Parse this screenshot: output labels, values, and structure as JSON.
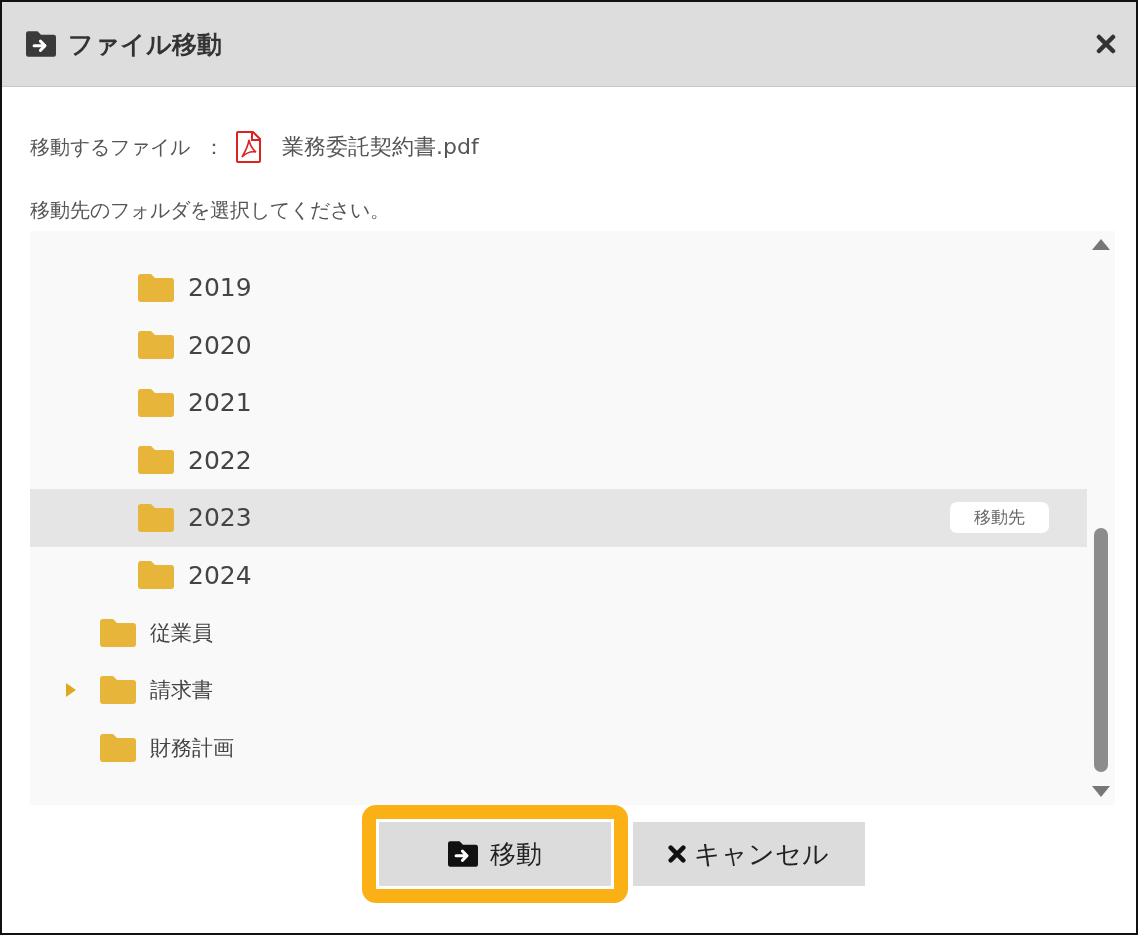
{
  "dialog": {
    "title": "ファイル移動",
    "file_label": "移動するファイル",
    "separator": "：",
    "file_name": "業務委託契約書.pdf",
    "instruction": "移動先のフォルダを選択してください。"
  },
  "tree": [
    {
      "children": [
        {
          "label": "2019",
          "selected": false
        },
        {
          "label": "2020",
          "selected": false
        },
        {
          "label": "2021",
          "selected": false
        },
        {
          "label": "2022",
          "selected": false
        },
        {
          "label": "2023",
          "selected": true,
          "badge": "移動先"
        },
        {
          "label": "2024",
          "selected": false
        }
      ]
    },
    {
      "label": "従業員",
      "selected": false
    },
    {
      "label": "請求書",
      "selected": false,
      "expanded": false
    },
    {
      "label": "財務計画",
      "selected": false
    }
  ],
  "buttons": [
    {
      "label": "移動",
      "kind": "move",
      "highlighted": true
    },
    {
      "label": "キャンセル",
      "kind": "cancel",
      "highlighted": false
    }
  ]
}
